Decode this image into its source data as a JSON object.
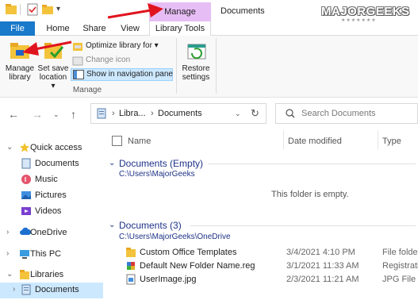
{
  "window": {
    "title": "Documents",
    "context_tab_header": "Manage"
  },
  "watermark": {
    "logo": "MAJORGEEKS",
    "stars": "★★★★★★★"
  },
  "tabs": {
    "file": "File",
    "home": "Home",
    "share": "Share",
    "view": "View",
    "library_tools": "Library Tools"
  },
  "ribbon": {
    "manage_library": [
      "Manage",
      "library"
    ],
    "set_save_location": [
      "Set save",
      "location ▾"
    ],
    "optimize_library": "Optimize library for ▾",
    "change_icon": "Change icon",
    "show_in_nav_pane": "Show in navigation pane",
    "restore_settings": [
      "Restore",
      "settings"
    ],
    "group_label": "Manage"
  },
  "address": {
    "crumb_libraries": "Libra...",
    "crumb_separator": "›",
    "crumb_documents": "Documents",
    "search_placeholder": "Search Documents"
  },
  "nav": {
    "quick_access": "Quick access",
    "quick_items": [
      "Documents",
      "Music",
      "Pictures",
      "Videos"
    ],
    "onedrive": "OneDrive",
    "this_pc": "This PC",
    "libraries": "Libraries",
    "libraries_documents": "Documents"
  },
  "columns": {
    "name": "Name",
    "date_modified": "Date modified",
    "type": "Type"
  },
  "groups": [
    {
      "title": "Documents (Empty)",
      "path": "C:\\Users\\MajorGeeks",
      "empty_message": "This folder is empty."
    },
    {
      "title": "Documents (3)",
      "path": "C:\\Users\\MajorGeeks\\OneDrive",
      "files": [
        {
          "name": "Custom Office Templates",
          "date": "3/4/2021 4:10 PM",
          "type": "File folder",
          "icon": "folder-icon"
        },
        {
          "name": "Default New Folder Name.reg",
          "date": "3/1/2021 11:33 AM",
          "type": "Registratio",
          "icon": "registry-file-icon"
        },
        {
          "name": "UserImage.jpg",
          "date": "2/3/2021 11:21 AM",
          "type": "JPG File",
          "icon": "image-file-icon"
        }
      ]
    }
  ],
  "colors": {
    "file_tab": "#1979ca",
    "context_tab": "#e7bdf5",
    "group_title": "#1e3287",
    "selection": "#cce8ff",
    "annotation_arrow": "#e0141e"
  }
}
